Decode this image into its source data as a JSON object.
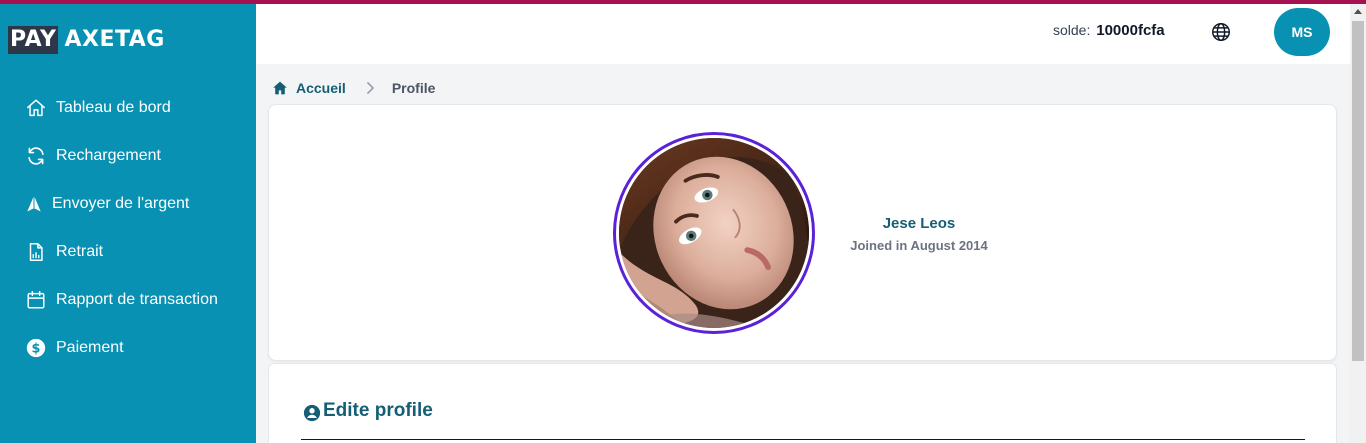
{
  "brand": {
    "part1": "PAY",
    "part2": "AXETAG"
  },
  "colors": {
    "sidebar": "#0891b2",
    "accent": "#155e75",
    "top_strip": "#a6124f",
    "photo_ring": "#5b21d6"
  },
  "sidebar": {
    "items": [
      {
        "label": "Tableau de bord",
        "icon": "home-icon"
      },
      {
        "label": "Rechargement",
        "icon": "refresh-icon"
      },
      {
        "label": "Envoyer de l'argent",
        "icon": "send-icon"
      },
      {
        "label": "Retrait",
        "icon": "report-icon"
      },
      {
        "label": "Rapport de transaction",
        "icon": "calendar-icon"
      },
      {
        "label": "Paiement",
        "icon": "dollar-icon"
      }
    ]
  },
  "header": {
    "balance_label": "solde:",
    "balance_value": "10000fcfa",
    "language_icon": "globe-icon",
    "user_initials": "MS"
  },
  "breadcrumb": {
    "home": "Accueil",
    "current": "Profile"
  },
  "profile": {
    "name": "Jese Leos",
    "joined": "Joined in August 2014"
  },
  "edit_section": {
    "title": "Edite profile",
    "icon": "user-circle-icon"
  }
}
